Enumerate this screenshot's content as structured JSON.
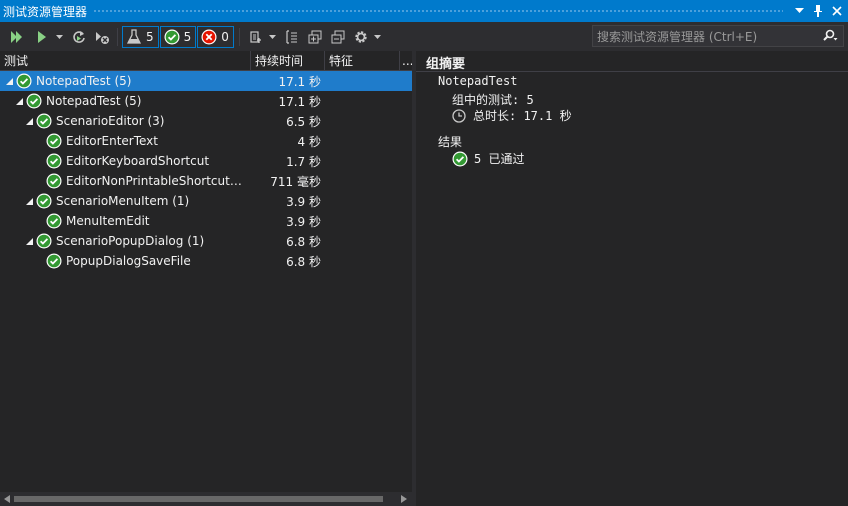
{
  "window": {
    "title": "测试资源管理器"
  },
  "toolbar": {
    "run_all": "run-all",
    "filters": [
      {
        "name": "all",
        "count": "5"
      },
      {
        "name": "passed",
        "count": "5"
      },
      {
        "name": "failed",
        "count": "0"
      }
    ],
    "search_placeholder": "搜索测试资源管理器 (Ctrl+E)"
  },
  "columns": {
    "name": "测试",
    "duration": "持续时间",
    "traits": "特征",
    "more": "..."
  },
  "tests": [
    {
      "name": "NotepadTest (5)",
      "duration": "17.1 秒",
      "level": 0,
      "expanded": true,
      "selected": true
    },
    {
      "name": "NotepadTest (5)",
      "duration": "17.1 秒",
      "level": 1,
      "expanded": true
    },
    {
      "name": "ScenarioEditor (3)",
      "duration": "6.5 秒",
      "level": 2,
      "expanded": true
    },
    {
      "name": "EditorEnterText",
      "duration": "4 秒",
      "level": 3
    },
    {
      "name": "EditorKeyboardShortcut",
      "duration": "1.7 秒",
      "level": 3
    },
    {
      "name": "EditorNonPrintableShortcutK...",
      "duration": "711 毫秒",
      "level": 3
    },
    {
      "name": "ScenarioMenuItem (1)",
      "duration": "3.9 秒",
      "level": 2,
      "expanded": true
    },
    {
      "name": "MenuItemEdit",
      "duration": "3.9 秒",
      "level": 3
    },
    {
      "name": "ScenarioPopupDialog (1)",
      "duration": "6.8 秒",
      "level": 2,
      "expanded": true
    },
    {
      "name": "PopupDialogSaveFile",
      "duration": "6.8 秒",
      "level": 3
    }
  ],
  "summary": {
    "heading": "组摘要",
    "group": "NotepadTest",
    "count": "组中的测试: 5",
    "total_time": "总时长: 17.1 秒",
    "results_label": "结果",
    "passed": "5 已通过"
  },
  "colors": {
    "accent": "#007acc",
    "selected": "#1f7ccb",
    "pass": "#339933",
    "fail": "#e51400"
  }
}
